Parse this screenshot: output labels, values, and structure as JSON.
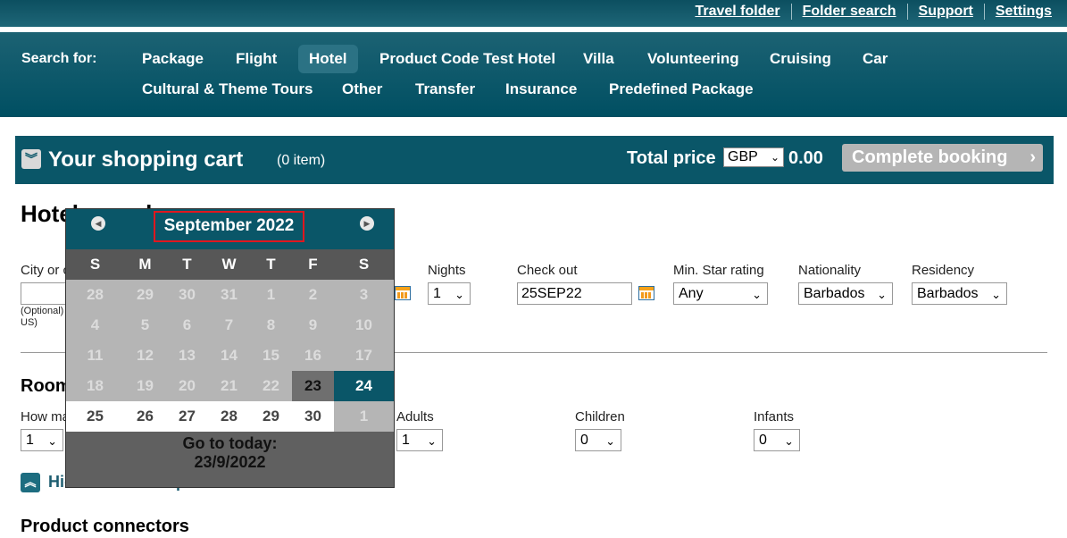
{
  "toplinks": [
    "Travel folder",
    "Folder search",
    "Support",
    "Settings"
  ],
  "nav": {
    "search_for": "Search for:",
    "row1": [
      "Package",
      "Flight",
      "Hotel",
      "Product Code Test Hotel",
      "Villa",
      "Volunteering",
      "Cruising",
      "Car"
    ],
    "row2": [
      "Cultural & Theme Tours",
      "Other",
      "Transfer",
      "Insurance",
      "Predefined Package"
    ],
    "active": "Hotel"
  },
  "cart": {
    "title": "Your shopping cart",
    "count": "(0 item)",
    "total_label": "Total price",
    "currency": "GBP",
    "amount": "0.00",
    "complete_label": "Complete booking"
  },
  "hotel_search": {
    "title": "Hotel search",
    "city_label": "City or country",
    "city_hint_1": "(Optional)",
    "city_hint_2": "US)",
    "nights_label": "Nights",
    "nights_value": "1",
    "checkout_label": "Check out",
    "checkout_value": "25SEP22",
    "star_label": "Min. Star rating",
    "star_value": "Any",
    "nationality_label": "Nationality",
    "nationality_value": "Barbados",
    "residency_label": "Residency",
    "residency_value": "Barbados"
  },
  "rooms": {
    "title": "Rooms",
    "how_many_label": "How many rooms",
    "how_many_value": "1",
    "adults_label": "Adults",
    "adults_value": "1",
    "children_label": "Children",
    "children_value": "0",
    "infants_label": "Infants",
    "infants_value": "0"
  },
  "hide_options": "Hide advanced options",
  "product_connectors": "Product connectors",
  "datepicker": {
    "month": "September 2022",
    "weekdays": [
      "S",
      "M",
      "T",
      "W",
      "T",
      "F",
      "S"
    ],
    "weeks": [
      [
        "28",
        "29",
        "30",
        "31",
        "1",
        "2",
        "3"
      ],
      [
        "4",
        "5",
        "6",
        "7",
        "8",
        "9",
        "10"
      ],
      [
        "11",
        "12",
        "13",
        "14",
        "15",
        "16",
        "17"
      ],
      [
        "18",
        "19",
        "20",
        "21",
        "22",
        "23",
        "24"
      ],
      [
        "25",
        "26",
        "27",
        "28",
        "29",
        "30",
        "1"
      ]
    ],
    "today": "23",
    "selected": "24",
    "goto_today": "Go to today:",
    "today_date": "23/9/2022"
  },
  "colors": {
    "brand": "#0a5668",
    "today_cell": "#6f6f6f",
    "disabled_cell": "#b5b5b5",
    "selectable_cell": "#ffffff",
    "month_highlight": "#e0171f"
  }
}
